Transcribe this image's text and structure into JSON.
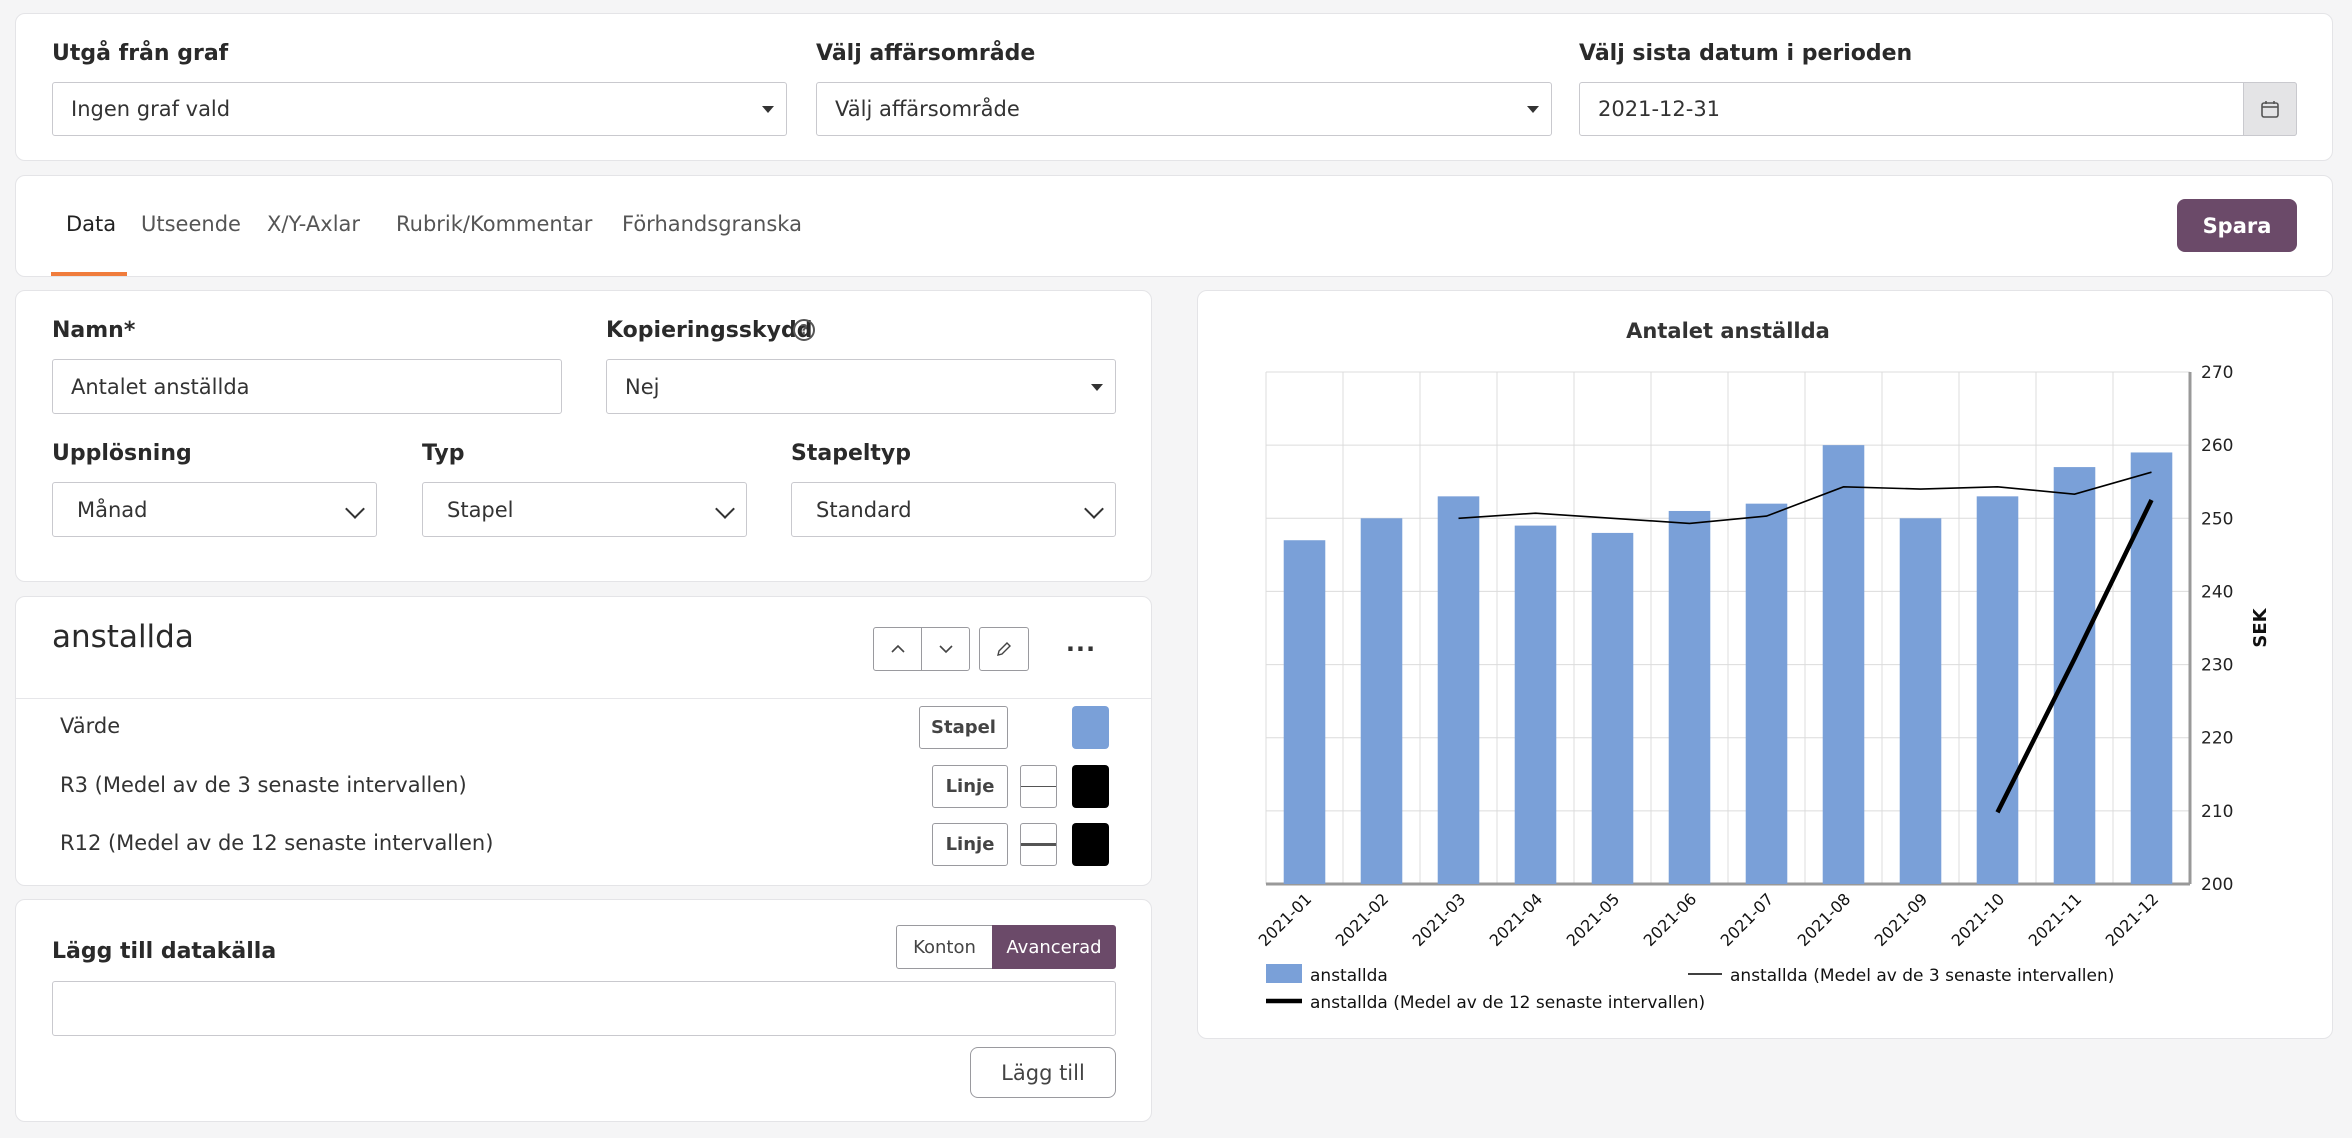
{
  "filters": {
    "graph": {
      "label": "Utgå från graf",
      "value": "Ingen graf vald"
    },
    "area": {
      "label": "Välj affärsområde",
      "value": "Välj affärsområde"
    },
    "date": {
      "label": "Välj sista datum i perioden",
      "value": "2021-12-31",
      "icon": "calendar-icon"
    }
  },
  "tabs": [
    "Data",
    "Utseende",
    "X/Y-Axlar",
    "Rubrik/Kommentar",
    "Förhandsgranska"
  ],
  "active_tab": "Data",
  "save_label": "Spara",
  "accent": "#6b4a69",
  "tab_underline": "#f07c3c",
  "form": {
    "name_label": "Namn*",
    "name_value": "Antalet anställda",
    "copy_label": "Kopieringsskydd",
    "copy_value": "Nej",
    "resolution_label": "Upplösning",
    "resolution_value": "Månad",
    "type_label": "Typ",
    "type_value": "Stapel",
    "bartype_label": "Stapeltyp",
    "bartype_value": "Standard"
  },
  "series_panel": {
    "title": "anstallda",
    "rows": [
      {
        "label": "Värde",
        "button": "Stapel",
        "color": "#7aa0d8"
      },
      {
        "label": "R3 (Medel av de 3 senaste intervallen)",
        "button": "Linje",
        "color": "#000000"
      },
      {
        "label": "R12 (Medel av de 12 senaste intervallen)",
        "button": "Linje",
        "color": "#000000"
      }
    ]
  },
  "datasource": {
    "label": "Lägg till datakälla",
    "mode_konton": "Konton",
    "mode_avancerad": "Avancerad",
    "input_value": "",
    "add_label": "Lägg till"
  },
  "chart_data": {
    "type": "bar",
    "title": "Antalet anställda",
    "ylabel": "SEK",
    "ylim": [
      200,
      270
    ],
    "yticks": [
      200,
      210,
      220,
      230,
      240,
      250,
      260,
      270
    ],
    "y_axis_side": "right",
    "grid": true,
    "categories": [
      "2021-01",
      "2021-02",
      "2021-03",
      "2021-04",
      "2021-05",
      "2021-06",
      "2021-07",
      "2021-08",
      "2021-09",
      "2021-10",
      "2021-11",
      "2021-12"
    ],
    "series": [
      {
        "name": "anstallda",
        "kind": "bar",
        "color": "#7aa0d8",
        "values": [
          247,
          250,
          253,
          249,
          248,
          251,
          252,
          260,
          250,
          253,
          257,
          259
        ]
      },
      {
        "name": "anstallda (Medel av de 3 senaste intervallen)",
        "kind": "line",
        "color": "#000000",
        "values": [
          null,
          null,
          250,
          250.7,
          250,
          249.3,
          250.3,
          254.3,
          254,
          254.3,
          253.3,
          256.3
        ]
      },
      {
        "name": "anstallda (Medel av de 12 senaste intervallen)",
        "kind": "line",
        "color": "#000000",
        "values": [
          null,
          null,
          null,
          null,
          null,
          null,
          null,
          null,
          null,
          209.8,
          230.8,
          252.5
        ]
      }
    ],
    "legend_position": "bottom"
  }
}
